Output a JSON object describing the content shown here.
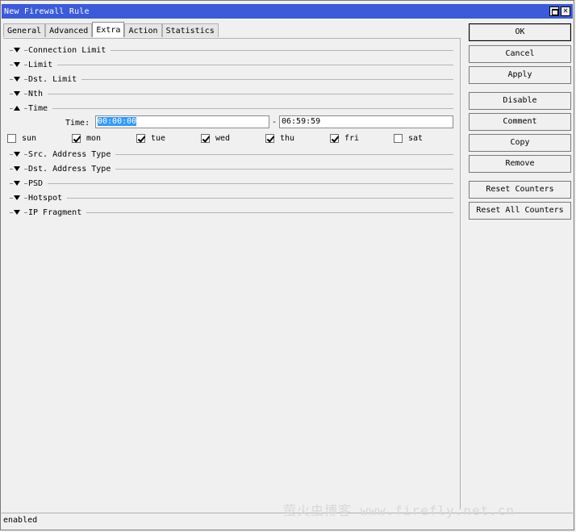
{
  "window": {
    "title": "New Firewall Rule"
  },
  "tabs": [
    {
      "label": "General"
    },
    {
      "label": "Advanced"
    },
    {
      "label": "Extra"
    },
    {
      "label": "Action"
    },
    {
      "label": "Statistics"
    }
  ],
  "sections": [
    {
      "label": "Connection Limit",
      "state": "collapsed"
    },
    {
      "label": "Limit",
      "state": "collapsed"
    },
    {
      "label": "Dst. Limit",
      "state": "collapsed"
    },
    {
      "label": "Nth",
      "state": "collapsed"
    },
    {
      "label": "Time",
      "state": "expanded"
    },
    {
      "label": "Src. Address Type",
      "state": "collapsed"
    },
    {
      "label": "Dst. Address Type",
      "state": "collapsed"
    },
    {
      "label": "PSD",
      "state": "collapsed"
    },
    {
      "label": "Hotspot",
      "state": "collapsed"
    },
    {
      "label": "IP Fragment",
      "state": "collapsed"
    }
  ],
  "time": {
    "label": "Time:",
    "from": "00:00:00",
    "separator": "-",
    "to": "06:59:59"
  },
  "days": [
    {
      "label": "sun",
      "checked": false
    },
    {
      "label": "mon",
      "checked": true
    },
    {
      "label": "tue",
      "checked": true
    },
    {
      "label": "wed",
      "checked": true
    },
    {
      "label": "thu",
      "checked": true
    },
    {
      "label": "fri",
      "checked": true
    },
    {
      "label": "sat",
      "checked": false
    }
  ],
  "buttons": {
    "ok": "OK",
    "cancel": "Cancel",
    "apply": "Apply",
    "disable": "Disable",
    "comment": "Comment",
    "copy": "Copy",
    "remove": "Remove",
    "reset_counters": "Reset Counters",
    "reset_all_counters": "Reset All Counters"
  },
  "status": {
    "text": "enabled"
  },
  "watermark": "萤火虫博客 www.firefly.net.cn",
  "colors": {
    "titlebar": "#3b5bdb",
    "selection": "#3399ff"
  }
}
